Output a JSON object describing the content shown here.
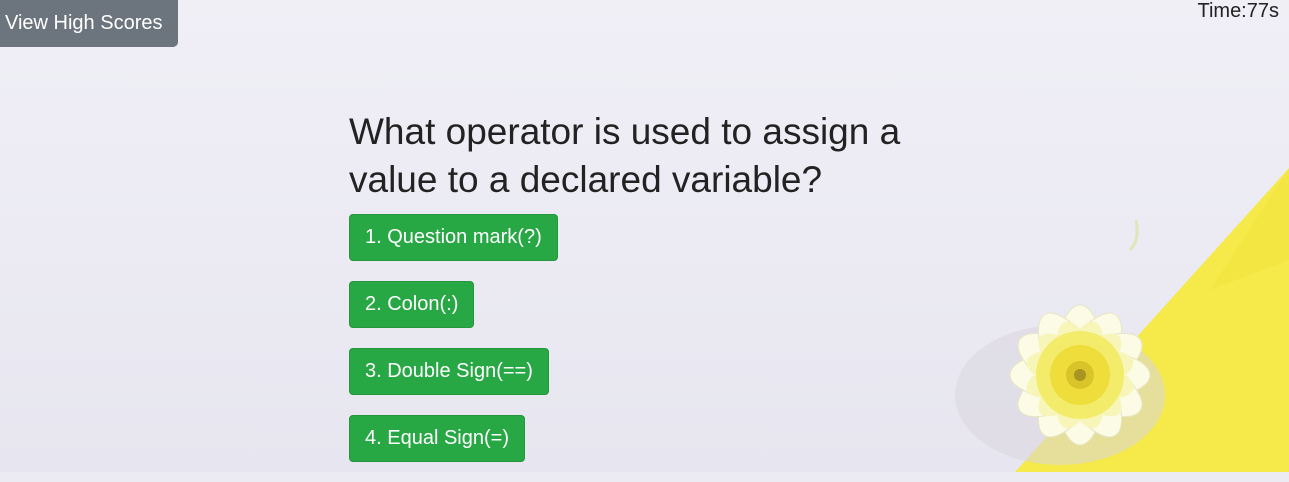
{
  "header": {
    "high_scores_label": "View High Scores",
    "timer_text": "Time:77s"
  },
  "quiz": {
    "question": "What operator is used to assign a value to a declared variable?",
    "answers": [
      {
        "label": "1. Question mark(?)"
      },
      {
        "label": "2. Colon(:)"
      },
      {
        "label": "3. Double Sign(==)"
      },
      {
        "label": "4. Equal Sign(=)"
      }
    ]
  },
  "colors": {
    "answer_button": "#28a745",
    "high_scores_button": "#6c757d",
    "background": "#ecebf3",
    "accent_yellow": "#f6ea4a"
  }
}
